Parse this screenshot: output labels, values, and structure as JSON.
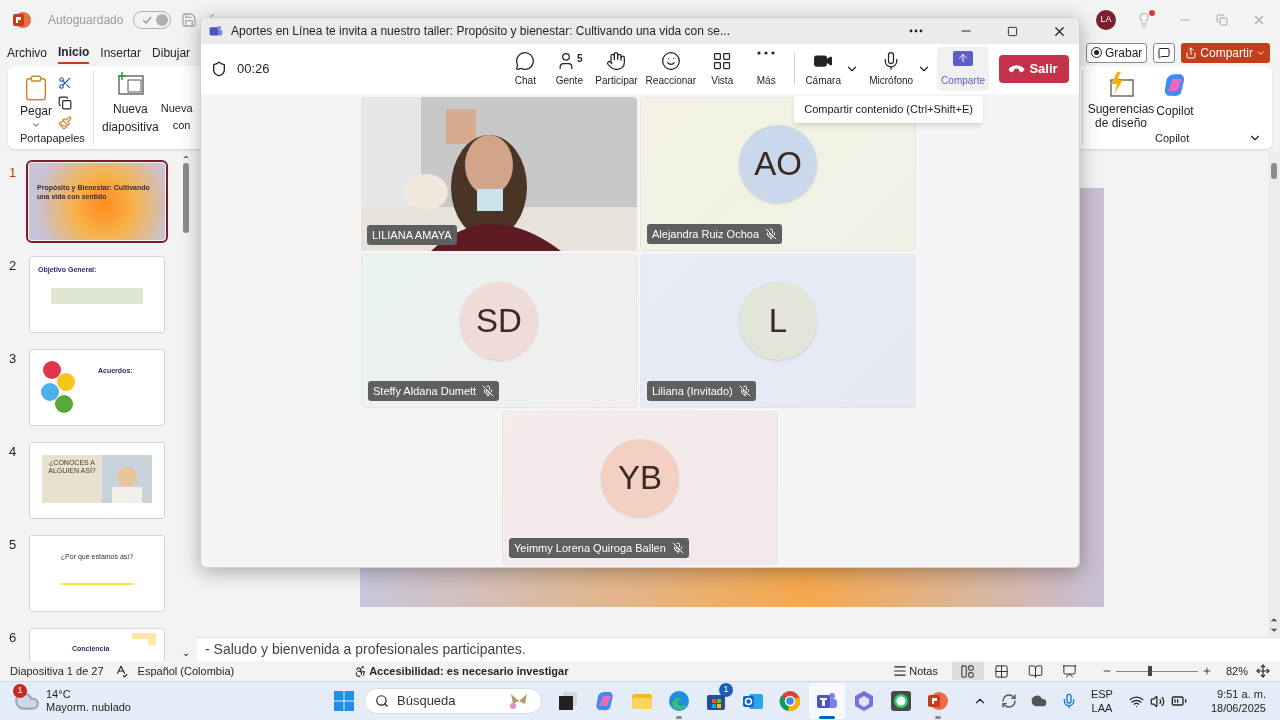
{
  "powerpoint": {
    "title_bar": {
      "autosave": {
        "label": "Autoguardado",
        "on": true
      },
      "avatar": "LA"
    },
    "ribbon_tabs": [
      {
        "label": "Archivo",
        "selected": false
      },
      {
        "label": "Inicio",
        "selected": true
      },
      {
        "label": "Insertar",
        "selected": false
      },
      {
        "label": "Dibujar",
        "selected": false
      }
    ],
    "ribbon_actions": {
      "record": "Grabar",
      "share": "Compartir"
    },
    "ribbon_left": {
      "paste": "Pegar",
      "group": "Portapapeles",
      "new_slide": [
        "Nueva",
        "diapositiva"
      ],
      "partial": [
        "Nueva",
        "con"
      ]
    },
    "ribbon_right": {
      "design": [
        "Sugerencias",
        "de diseño"
      ],
      "copilot": "Copilot",
      "group": "Copilot"
    },
    "slides": [
      {
        "number": "1",
        "selected": true,
        "kind": "cover",
        "title": "Propósito y Bienestar: Cultivando una vida con sentido"
      },
      {
        "number": "2",
        "selected": false,
        "kind": "objective",
        "title": "Objetivo General:"
      },
      {
        "number": "3",
        "selected": false,
        "kind": "emoji",
        "title": "Acuerdos:"
      },
      {
        "number": "4",
        "selected": false,
        "title": "¿CONOCES A ALGUIEN ASÍ?"
      },
      {
        "number": "5",
        "selected": false,
        "kind": "bar",
        "title": "¿Por qué estamos así?"
      },
      {
        "number": "6",
        "selected": false,
        "kind": "partial",
        "title": "Conciencia"
      }
    ],
    "notes": "- Saludo y bienvenida a profesionales participantes.",
    "status_bar": {
      "slide": "Diapositiva 1 de 27",
      "language": "Español (Colombia)",
      "accessibility": "Accesibilidad: es necesario investigar",
      "notes": "Notas",
      "views": [
        {
          "kind": "normal",
          "selected": true
        },
        {
          "kind": "sorter",
          "selected": false
        },
        {
          "kind": "reading",
          "selected": false
        },
        {
          "kind": "show",
          "selected": false
        }
      ],
      "zoom_slider": {
        "level": 0.41
      },
      "zoom": "82%"
    }
  },
  "teams": {
    "title": "Aportes en Línea te invita a nuestro taller: Propósito y bienestar: Cultivando una vida con se...",
    "timer": "00:26",
    "toolbar": [
      {
        "kind": "chat",
        "label": "Chat",
        "highlighted": false,
        "dropdown": false
      },
      {
        "kind": "people",
        "label": "Gente",
        "count": "5",
        "highlighted": false,
        "dropdown": false
      },
      {
        "kind": "raise",
        "label": "Participar",
        "highlighted": false,
        "dropdown": false
      },
      {
        "kind": "react",
        "label": "Reaccionar",
        "highlighted": false,
        "dropdown": false
      },
      {
        "kind": "view",
        "label": "Vista",
        "highlighted": false,
        "dropdown": false
      },
      {
        "kind": "more",
        "label": "Más",
        "highlighted": false,
        "dropdown": false
      },
      {
        "kind": "camera",
        "label": "Cámara",
        "highlighted": false,
        "dropdown": true
      },
      {
        "kind": "mic",
        "label": "Micrófono",
        "highlighted": false,
        "dropdown": true
      },
      {
        "kind": "share",
        "label": "Comparte",
        "highlighted": true,
        "dropdown": false
      }
    ],
    "leave": "Salir",
    "tooltip": "Compartir contenido (Ctrl+Shift+E)",
    "participants": [
      {
        "kind": "video",
        "name": "LILIANA AMAYA",
        "muted": false
      },
      {
        "kind": "avatar",
        "name": "Alejandra Ruiz Ochoa",
        "initials": "AO",
        "color": "#c9d8ea",
        "muted": true
      },
      {
        "kind": "avatar",
        "name": "Steffy Aldana Dumett",
        "initials": "SD",
        "color": "#efdcd6",
        "muted": true
      },
      {
        "kind": "avatar",
        "name": "Liliana (Invitado)",
        "initials": "L",
        "color": "#e2e5d8",
        "muted": true
      },
      {
        "kind": "avatar",
        "name": "Yeimmy Lorena Quiroga Ballen",
        "initials": "YB",
        "color": "#f3d0c2",
        "muted": true
      }
    ]
  },
  "taskbar": {
    "weather": {
      "badge": "1",
      "temp": "14°C",
      "text": "Mayorm. nublado"
    },
    "search": "Búsqueda",
    "apps": [
      {
        "kind": "taskview",
        "running": false,
        "selected": false
      },
      {
        "kind": "copilot",
        "running": false,
        "selected": false
      },
      {
        "kind": "explorer",
        "running": false,
        "selected": false
      },
      {
        "kind": "edge",
        "running": true,
        "selected": false
      },
      {
        "kind": "store",
        "running": false,
        "selected": false,
        "badge": "1"
      },
      {
        "kind": "outlook",
        "running": false,
        "selected": false
      },
      {
        "kind": "chrome",
        "running": false,
        "selected": false
      },
      {
        "kind": "teams",
        "running": true,
        "selected": true
      },
      {
        "kind": "m365",
        "running": false,
        "selected": false
      },
      {
        "kind": "whatsapp",
        "running": false,
        "selected": false
      },
      {
        "kind": "powerpoint",
        "running": true,
        "selected": false
      }
    ],
    "language": [
      "ESP",
      "LAA"
    ],
    "time": "9:51 a. m.",
    "date": "18/06/2025"
  }
}
